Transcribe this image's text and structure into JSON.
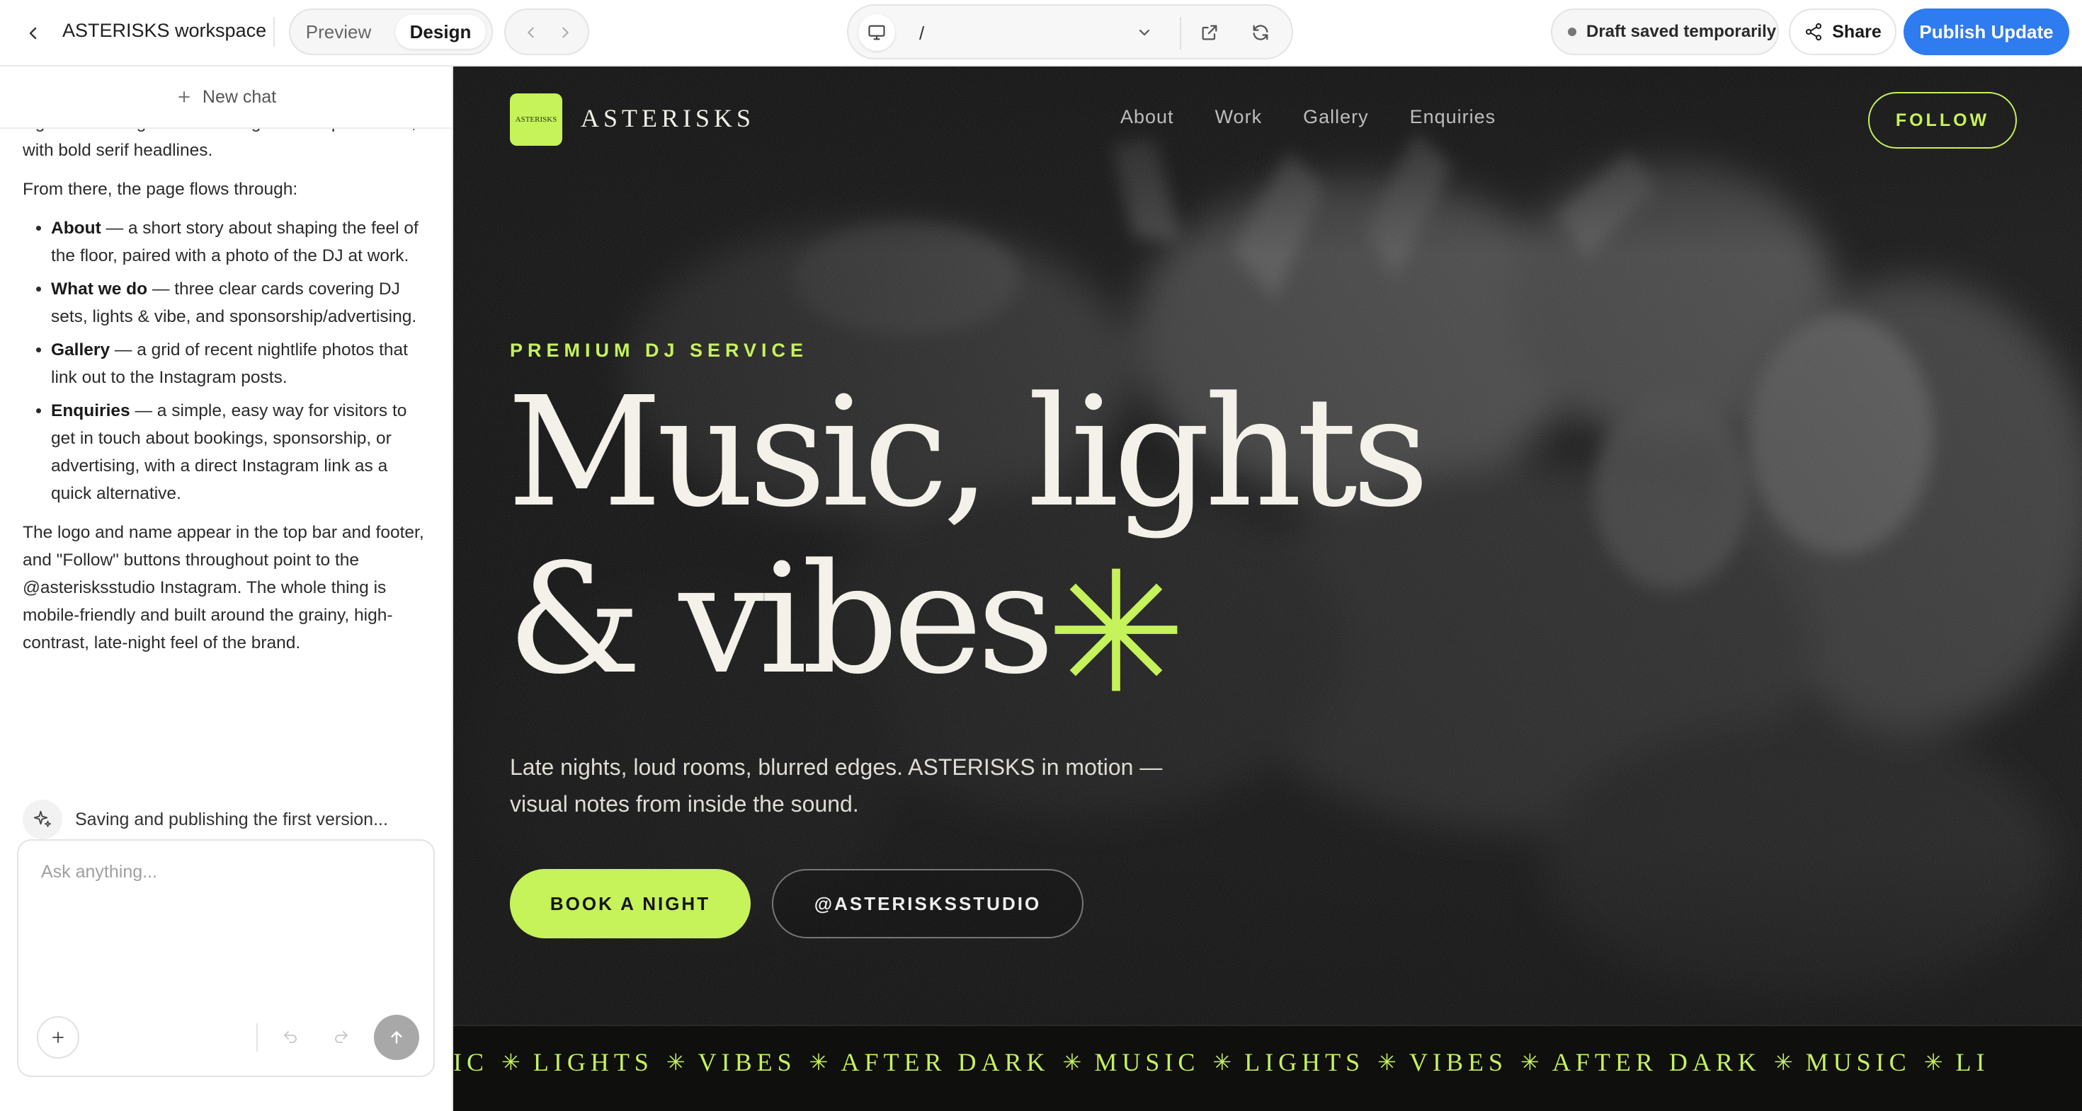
{
  "topbar": {
    "workspace_title": "ASTERISKS workspace",
    "view_modes": {
      "preview": "Preview",
      "design": "Design",
      "active": "Design"
    },
    "url_path": "/",
    "draft_status": "Draft saved temporarily",
    "share_label": "Share",
    "publish_label": "Publish Update",
    "accent_color": "#2f7bf0"
  },
  "chat": {
    "new_chat_label": "New chat",
    "intro_fragment": "signature acid-green accent against deep charcoal, with bold serif headlines.",
    "flow_intro": "From there, the page flows through:",
    "sections": [
      {
        "name": "About",
        "desc": "— a short story about shaping the feel of the floor, paired with a photo of the DJ at work."
      },
      {
        "name": "What we do",
        "desc": "— three clear cards covering DJ sets, lights & vibe, and sponsorship/advertising."
      },
      {
        "name": "Gallery",
        "desc": "— a grid of recent nightlife photos that link out to the Instagram posts."
      },
      {
        "name": "Enquiries",
        "desc": "— a simple, easy way for visitors to get in touch about bookings, sponsorship, or advertising, with a direct Instagram link as a quick alternative."
      }
    ],
    "closing": "The logo and name appear in the top bar and footer, and \"Follow\" buttons throughout point to the @asterisksstudio Instagram. The whole thing is mobile-friendly and built around the grainy, high-contrast, late-night feel of the brand.",
    "status_text": "Saving and publishing the first version...",
    "composer_placeholder": "Ask anything..."
  },
  "site": {
    "logo_text": "ASTERISKS",
    "brand_name": "ASTERISKS",
    "nav_links": [
      "About",
      "Work",
      "Gallery",
      "Enquiries"
    ],
    "follow_label": "FOLLOW",
    "eyebrow": "PREMIUM DJ SERVICE",
    "headline_line1": "Music, lights",
    "headline_line2": "& vibes",
    "subcopy": "Late nights, loud rooms, blurred edges. ASTERISKS in motion — visual notes from inside the sound.",
    "cta_primary": "BOOK A NIGHT",
    "cta_secondary": "@ASTERISKSSTUDIO",
    "marquee_items": [
      "USIC",
      "LIGHTS",
      "VIBES",
      "AFTER DARK",
      "MUSIC",
      "LIGHTS",
      "VIBES",
      "AFTER DARK",
      "MUSIC",
      "LI"
    ],
    "accent_color": "#c6f25a",
    "background_color": "#0c0c0c"
  }
}
